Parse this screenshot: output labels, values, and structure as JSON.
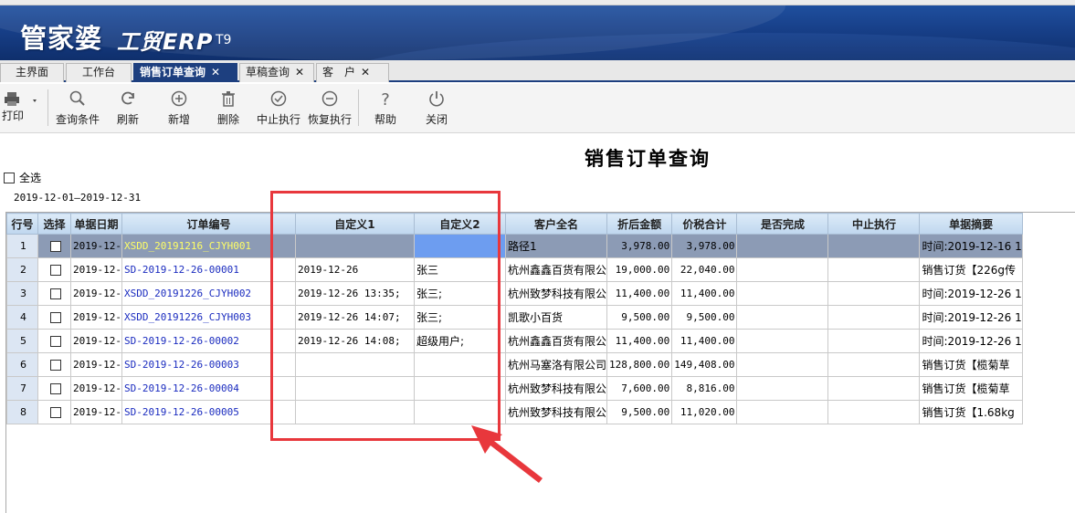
{
  "app": {
    "logo_main": "管家婆",
    "logo_sub": "工贸ERP",
    "logo_ver": "T9"
  },
  "tabs": [
    {
      "label": "主界面",
      "active": false,
      "closable": false
    },
    {
      "label": "工作台",
      "active": false,
      "closable": false
    },
    {
      "label": "销售订单查询",
      "active": true,
      "closable": true
    },
    {
      "label": "草稿查询",
      "active": false,
      "closable": true
    },
    {
      "label": "客　户",
      "active": false,
      "closable": true
    }
  ],
  "toolbar": {
    "print": "打印",
    "query": "查询条件",
    "refresh": "刷新",
    "add": "新增",
    "delete": "删除",
    "stop": "中止执行",
    "resume": "恢复执行",
    "help": "帮助",
    "close": "关闭"
  },
  "page": {
    "title": "销售订单查询",
    "select_all": "全选",
    "date_range": "2019-12-01—2019-12-31"
  },
  "grid": {
    "headers": [
      "行号",
      "选择",
      "单据日期",
      "订单编号",
      "自定义1",
      "自定义2",
      "客户全名",
      "折后金额",
      "价税合计",
      "是否完成",
      "中止执行",
      "单据摘要"
    ],
    "rows": [
      {
        "no": "1",
        "date": "2019-12-",
        "code": "XSDD_20191216_CJYH001",
        "c1": "",
        "c2": "",
        "customer": "路径1",
        "amount": "3,978.00",
        "total": "3,978.00",
        "done": "",
        "stop": "",
        "memo": "时间:2019-12-16 1"
      },
      {
        "no": "2",
        "date": "2019-12-",
        "code": "SD-2019-12-26-00001",
        "c1": "2019-12-26",
        "c2": "张三",
        "customer": "杭州鑫鑫百货有限公",
        "amount": "19,000.00",
        "total": "22,040.00",
        "done": "",
        "stop": "",
        "memo": "销售订货【226g传"
      },
      {
        "no": "3",
        "date": "2019-12-",
        "code": "XSDD_20191226_CJYH002",
        "c1": "2019-12-26 13:35;",
        "c2": "张三;",
        "customer": "杭州致梦科技有限公",
        "amount": "11,400.00",
        "total": "11,400.00",
        "done": "",
        "stop": "",
        "memo": "时间:2019-12-26 1"
      },
      {
        "no": "4",
        "date": "2019-12-",
        "code": "XSDD_20191226_CJYH003",
        "c1": "2019-12-26 14:07;",
        "c2": "张三;",
        "customer": "凯歌小百货",
        "amount": "9,500.00",
        "total": "9,500.00",
        "done": "",
        "stop": "",
        "memo": "时间:2019-12-26 1"
      },
      {
        "no": "5",
        "date": "2019-12-",
        "code": "SD-2019-12-26-00002",
        "c1": "2019-12-26 14:08;",
        "c2": "超级用户;",
        "customer": "杭州鑫鑫百货有限公",
        "amount": "11,400.00",
        "total": "11,400.00",
        "done": "",
        "stop": "",
        "memo": "时间:2019-12-26 1"
      },
      {
        "no": "6",
        "date": "2019-12-",
        "code": "SD-2019-12-26-00003",
        "c1": "",
        "c2": "",
        "customer": "杭州马塞洛有限公司",
        "amount": "128,800.00",
        "total": "149,408.00",
        "done": "",
        "stop": "",
        "memo": "销售订货【榄菊草"
      },
      {
        "no": "7",
        "date": "2019-12-",
        "code": "SD-2019-12-26-00004",
        "c1": "",
        "c2": "",
        "customer": "杭州致梦科技有限公",
        "amount": "7,600.00",
        "total": "8,816.00",
        "done": "",
        "stop": "",
        "memo": "销售订货【榄菊草"
      },
      {
        "no": "8",
        "date": "2019-12-",
        "code": "SD-2019-12-26-00005",
        "c1": "",
        "c2": "",
        "customer": "杭州致梦科技有限公",
        "amount": "9,500.00",
        "total": "11,020.00",
        "done": "",
        "stop": "",
        "memo": "销售订货【1.68kg"
      }
    ]
  },
  "colors": {
    "banner": "#1d3f7f",
    "selected_row": "#8c9bb5",
    "selected_cell": "#6d9df0",
    "code_link": "#1a2bbf",
    "annotation": "#e8373c"
  }
}
